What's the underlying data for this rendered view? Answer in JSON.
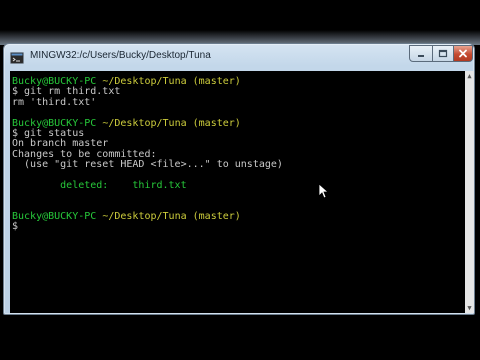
{
  "window": {
    "title": "MINGW32:/c/Users/Bucky/Desktop/Tuna"
  },
  "terminal": {
    "lines": [
      {
        "segments": [
          {
            "text": "Bucky@BUCKY-PC",
            "color": "green"
          },
          {
            "text": " ",
            "color": "plain"
          },
          {
            "text": "~/Desktop/Tuna (master)",
            "color": "yellow"
          }
        ]
      },
      {
        "segments": [
          {
            "text": "$ git rm third.txt",
            "color": "plain"
          }
        ]
      },
      {
        "segments": [
          {
            "text": "rm 'third.txt'",
            "color": "plain"
          }
        ]
      },
      {
        "segments": [
          {
            "text": "",
            "color": "plain"
          }
        ]
      },
      {
        "segments": [
          {
            "text": "Bucky@BUCKY-PC",
            "color": "green"
          },
          {
            "text": " ",
            "color": "plain"
          },
          {
            "text": "~/Desktop/Tuna (master)",
            "color": "yellow"
          }
        ]
      },
      {
        "segments": [
          {
            "text": "$ git status",
            "color": "plain"
          }
        ]
      },
      {
        "segments": [
          {
            "text": "On branch master",
            "color": "plain"
          }
        ]
      },
      {
        "segments": [
          {
            "text": "Changes to be committed:",
            "color": "plain"
          }
        ]
      },
      {
        "segments": [
          {
            "text": "  (use \"git reset HEAD <file>...\" to unstage)",
            "color": "plain"
          }
        ]
      },
      {
        "segments": [
          {
            "text": "",
            "color": "plain"
          }
        ]
      },
      {
        "segments": [
          {
            "text": "        deleted:    third.txt",
            "color": "green"
          }
        ]
      },
      {
        "segments": [
          {
            "text": "",
            "color": "plain"
          }
        ]
      },
      {
        "segments": [
          {
            "text": "",
            "color": "plain"
          }
        ]
      },
      {
        "segments": [
          {
            "text": "Bucky@BUCKY-PC",
            "color": "green"
          },
          {
            "text": " ",
            "color": "plain"
          },
          {
            "text": "~/Desktop/Tuna (master)",
            "color": "yellow"
          }
        ]
      },
      {
        "segments": [
          {
            "text": "$",
            "color": "plain"
          }
        ]
      }
    ]
  },
  "colors": {
    "prompt_user": "#27c83a",
    "prompt_path": "#cdcd3c",
    "text": "#c9c9c9",
    "background": "#000000"
  },
  "icons": {
    "app": "mingw-terminal-icon",
    "minimize": "minimize-icon",
    "maximize": "maximize-icon",
    "close": "close-icon",
    "cursor": "mouse-pointer-icon"
  }
}
